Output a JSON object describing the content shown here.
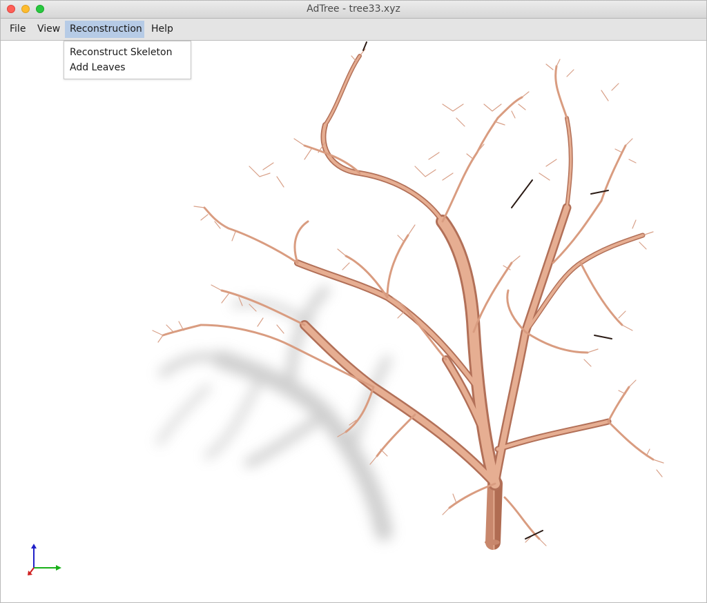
{
  "window": {
    "title": "AdTree - tree33.xyz"
  },
  "menubar": {
    "items": [
      {
        "label": "File"
      },
      {
        "label": "View"
      },
      {
        "label": "Reconstruction"
      },
      {
        "label": "Help"
      }
    ],
    "active_menu": "Reconstruction"
  },
  "reconstruction_menu": {
    "items": [
      {
        "label": "Reconstruct Skeleton"
      },
      {
        "label": "Add Leaves"
      }
    ]
  },
  "viewport": {
    "content": "tree-skeleton-model",
    "branch_color": "#e0a88a",
    "branch_shade_color": "#b87560",
    "shadow_color": "#b4b4b4",
    "background": "#ffffff"
  },
  "axes_indicator": {
    "x_color": "#d02020",
    "y_color": "#18b018",
    "z_color": "#2020c8"
  }
}
